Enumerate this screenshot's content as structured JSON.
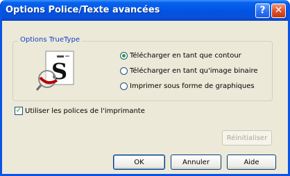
{
  "window": {
    "title": "Options Police/Texte avancées"
  },
  "titlebar_buttons": {
    "help": "?",
    "close": "✕"
  },
  "truetype": {
    "group_label": "Options TrueType",
    "options": [
      {
        "label": "Télécharger en tant que contour",
        "checked": true
      },
      {
        "label": "Télécharger en tant qu'image binaire",
        "checked": false
      },
      {
        "label": "Imprimer sous forme de graphiques",
        "checked": false
      }
    ]
  },
  "printer_fonts": {
    "label": "Utiliser les polices de l'imprimante",
    "checked": true
  },
  "buttons": {
    "reset": "Réinitialiser",
    "ok": "OK",
    "cancel": "Annuler",
    "help": "Aide"
  },
  "colors": {
    "titlebar": "#0055e5",
    "dialog_bg": "#ece9d8",
    "group_label": "#1040c8",
    "radio_dot": "#28a428"
  }
}
